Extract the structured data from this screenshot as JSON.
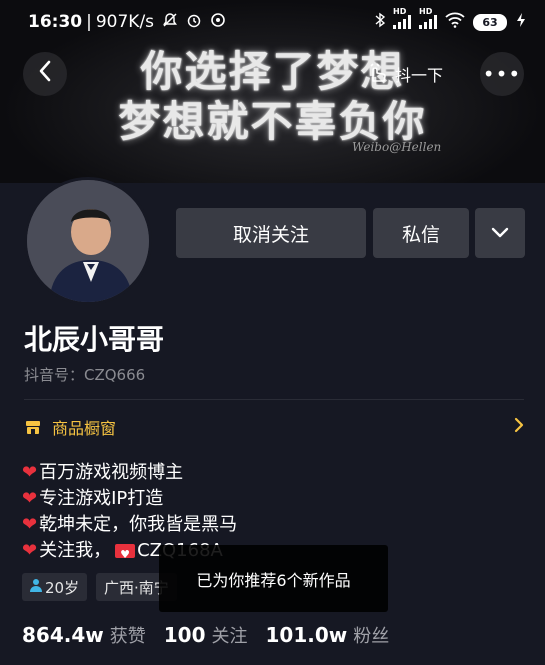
{
  "status_bar": {
    "time": "16:30",
    "net_speed": "907K/s",
    "battery": "63"
  },
  "banner": {
    "line1": "你选择了梦想",
    "line2": "梦想就不辜负你",
    "watermark": "Weibo@Hellen"
  },
  "header": {
    "share_label": "抖一下"
  },
  "actions": {
    "unfollow": "取消关注",
    "message": "私信"
  },
  "profile": {
    "name": "北辰小哥哥",
    "douyin_id": "抖音号：CZQ666"
  },
  "shop": {
    "label": "商品橱窗"
  },
  "bio": {
    "line1": "百万游戏视频博主",
    "line2": "专注游戏IP打造",
    "line3": "乾坤未定，你我皆是黑马",
    "line4_prefix": "关注我，",
    "line4_suffix": "CZQ168A"
  },
  "tags": {
    "age": "20岁",
    "location": "广西·南宁"
  },
  "stats": {
    "likes_num": "864.4w",
    "likes_label": "获赞",
    "following_num": "100",
    "following_label": "关注",
    "followers_num": "101.0w",
    "followers_label": "粉丝"
  },
  "toast": {
    "text": "已为你推荐6个新作品"
  },
  "colors": {
    "background": "#161823",
    "button": "#393b44",
    "accent_yellow": "#f6c342",
    "heart_red": "#e8313d"
  }
}
